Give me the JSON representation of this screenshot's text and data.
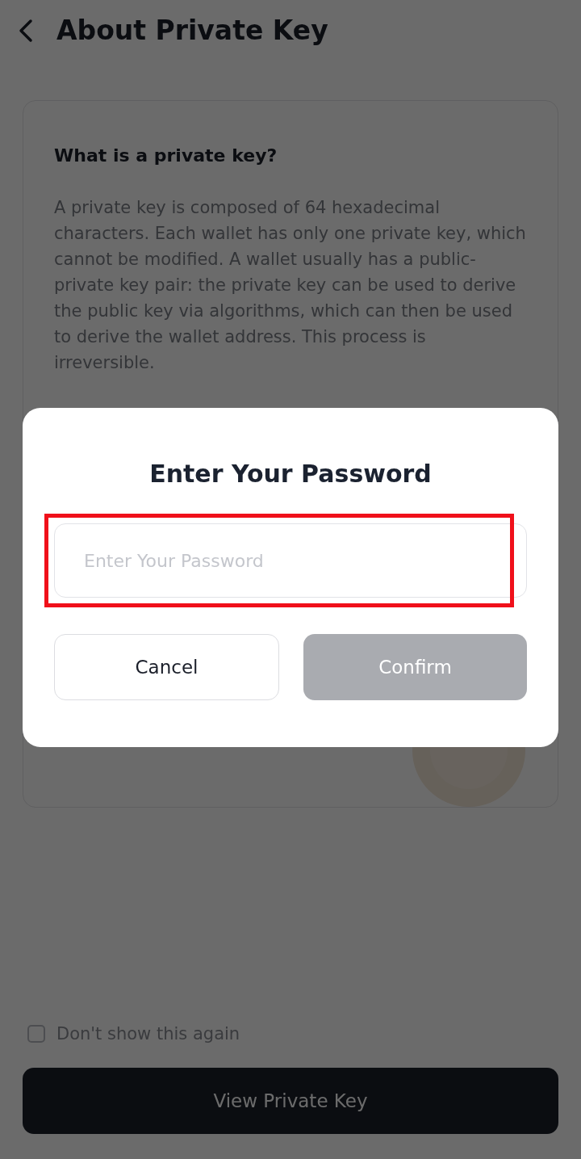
{
  "header": {
    "title": "About Private Key"
  },
  "card": {
    "heading": "What is a private key?",
    "body": "A private key is composed of 64 hexadecimal characters. Each wallet has only one private key, which cannot be modified. A wallet usually has a public-private key pair: the private key can be used to derive the public key via algorithms, which can then be used to derive the wallet address. This process is irreversible."
  },
  "dialog": {
    "title": "Enter Your Password",
    "password_field": {
      "placeholder": "Enter Your Password",
      "highlighted": true
    },
    "buttons": [
      {
        "label": "Cancel",
        "kind": "secondary",
        "disabled": false
      },
      {
        "label": "Confirm",
        "kind": "primary",
        "disabled": true
      }
    ]
  },
  "dont_show_again": {
    "label": "Don't show this again",
    "checked": false
  },
  "view_button": {
    "label": "View Private Key"
  }
}
